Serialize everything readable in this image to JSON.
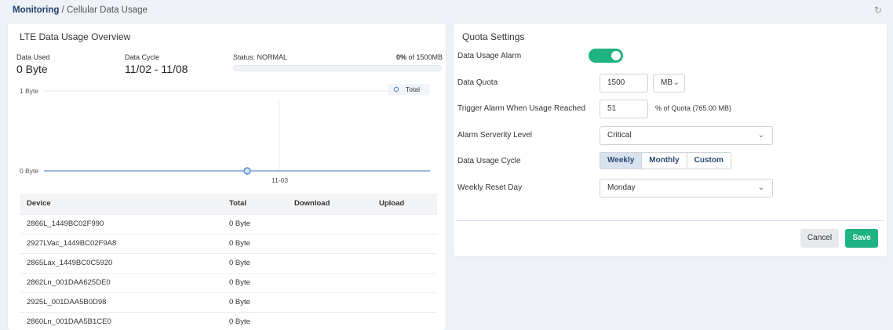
{
  "breadcrumb": {
    "section": "Monitoring",
    "separator": " / ",
    "page": "Cellular Data Usage"
  },
  "overview": {
    "title": "LTE Data Usage Overview",
    "data_used_label": "Data Used",
    "data_used_value": "0 Byte",
    "data_cycle_label": "Data Cycle",
    "data_cycle_value": "11/02 - 11/08",
    "status_text": "Status: NORMAL",
    "percent_text": "0%",
    "percent_of": " of 1500MB",
    "progress_fraction": 0.0
  },
  "chart_data": {
    "type": "line",
    "x": [
      "11-03"
    ],
    "series": [
      {
        "name": "Total",
        "values": [
          0
        ]
      }
    ],
    "ytick_labels": [
      "1 Byte",
      "0 Byte"
    ],
    "legend": "top-right"
  },
  "table": {
    "headers": [
      "Device",
      "Total",
      "Download",
      "Upload"
    ],
    "rows": [
      [
        "2866L_1449BC02F990",
        "0 Byte",
        "",
        ""
      ],
      [
        "2927LVac_1449BC02F9A8",
        "0 Byte",
        "",
        ""
      ],
      [
        "2865Lax_1449BC0C5920",
        "0 Byte",
        "",
        ""
      ],
      [
        "2862Ln_001DAA625DE0",
        "0 Byte",
        "",
        ""
      ],
      [
        "2925L_001DAA5B0D98",
        "0 Byte",
        "",
        ""
      ],
      [
        "2860Ln_001DAA5B1CE0",
        "0 Byte",
        "",
        ""
      ]
    ]
  },
  "quota": {
    "title": "Quota Settings",
    "alarm_label": "Data Usage Alarm",
    "alarm_on": true,
    "quota_label": "Data Quota",
    "quota_value": "1500",
    "quota_unit": "MB",
    "trigger_label": "Trigger Alarm When Usage Reached",
    "trigger_value": "51",
    "trigger_suffix": "% of Quota (765.00 MB)",
    "severity_label": "Alarm Serverity Level",
    "severity_value": "Critical",
    "cycle_label": "Data Usage Cycle",
    "cycle_options": [
      "Weekly",
      "Monthly",
      "Custom"
    ],
    "cycle_selected": "Weekly",
    "reset_label": "Weekly Reset Day",
    "reset_value": "Monday",
    "cancel_label": "Cancel",
    "save_label": "Save"
  },
  "colors": {
    "accent": "#1fb383",
    "chart_line": "#5b8fd6",
    "title_blue": "#1f3d6b"
  }
}
